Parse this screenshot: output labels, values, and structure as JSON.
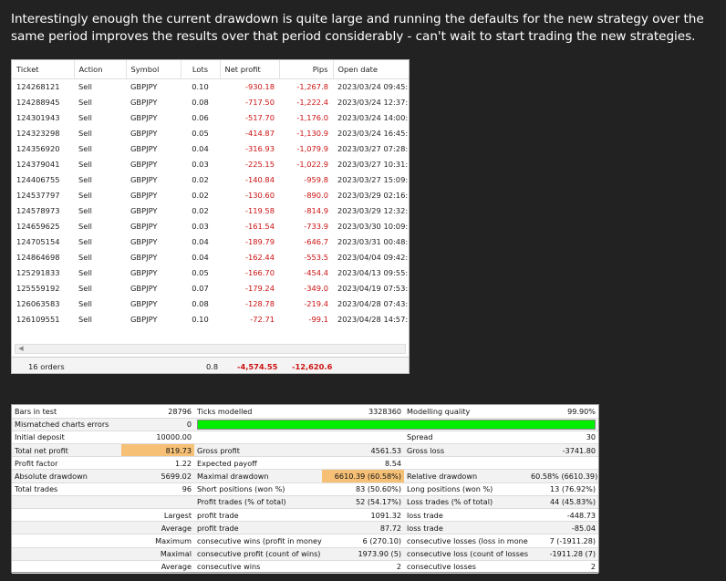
{
  "intro": "Interestingly enough the current drawdown is quite large and running the defaults for the new strategy over the same period improves the results over that period considerably - can't wait to start trading the new strategies.",
  "orders": {
    "columns": [
      "Ticket",
      "Action",
      "Symbol",
      "Lots",
      "Net profit",
      "Pips",
      "Open date"
    ],
    "rows": [
      [
        "124268121",
        "Sell",
        "GBPJPY",
        "0.10",
        "-930.18",
        "-1,267.8",
        "2023/03/24 09:45:..."
      ],
      [
        "124288945",
        "Sell",
        "GBPJPY",
        "0.08",
        "-717.50",
        "-1,222.4",
        "2023/03/24 12:37:..."
      ],
      [
        "124301943",
        "Sell",
        "GBPJPY",
        "0.06",
        "-517.70",
        "-1,176.0",
        "2023/03/24 14:00:..."
      ],
      [
        "124323298",
        "Sell",
        "GBPJPY",
        "0.05",
        "-414.87",
        "-1,130.9",
        "2023/03/24 16:45:..."
      ],
      [
        "124356920",
        "Sell",
        "GBPJPY",
        "0.04",
        "-316.93",
        "-1,079.9",
        "2023/03/27 07:28:..."
      ],
      [
        "124379041",
        "Sell",
        "GBPJPY",
        "0.03",
        "-225.15",
        "-1,022.9",
        "2023/03/27 10:31:..."
      ],
      [
        "124406755",
        "Sell",
        "GBPJPY",
        "0.02",
        "-140.84",
        "-959.8",
        "2023/03/27 15:09:..."
      ],
      [
        "124537797",
        "Sell",
        "GBPJPY",
        "0.02",
        "-130.60",
        "-890.0",
        "2023/03/29 02:16:..."
      ],
      [
        "124578973",
        "Sell",
        "GBPJPY",
        "0.02",
        "-119.58",
        "-814.9",
        "2023/03/29 12:32:..."
      ],
      [
        "124659625",
        "Sell",
        "GBPJPY",
        "0.03",
        "-161.54",
        "-733.9",
        "2023/03/30 10:09:..."
      ],
      [
        "124705154",
        "Sell",
        "GBPJPY",
        "0.04",
        "-189.79",
        "-646.7",
        "2023/03/31 00:48:..."
      ],
      [
        "124864698",
        "Sell",
        "GBPJPY",
        "0.04",
        "-162.44",
        "-553.5",
        "2023/04/04 09:42:..."
      ],
      [
        "125291833",
        "Sell",
        "GBPJPY",
        "0.05",
        "-166.70",
        "-454.4",
        "2023/04/13 09:55:..."
      ],
      [
        "125559192",
        "Sell",
        "GBPJPY",
        "0.07",
        "-179.24",
        "-349.0",
        "2023/04/19 07:53:..."
      ],
      [
        "126063583",
        "Sell",
        "GBPJPY",
        "0.08",
        "-128.78",
        "-219.4",
        "2023/04/28 07:43:..."
      ],
      [
        "126109551",
        "Sell",
        "GBPJPY",
        "0.10",
        "-72.71",
        "-99.1",
        "2023/04/28 14:57:..."
      ]
    ],
    "summary": {
      "count": "16 orders",
      "lots": "0.8",
      "net_profit": "-4,574.55",
      "pips": "-12,620.6"
    }
  },
  "report": {
    "rows": [
      [
        "Bars in test",
        "28796",
        "Ticks modelled",
        "3328360",
        "Modelling quality",
        "99.90%"
      ],
      [
        "Mismatched charts errors",
        "0",
        "__bar__",
        "",
        "",
        ""
      ],
      [
        "Initial deposit",
        "10000.00",
        "",
        "",
        "Spread",
        "30"
      ],
      [
        "Total net profit",
        "819.73",
        "Gross profit",
        "4561.53",
        "Gross loss",
        "-3741.80"
      ],
      [
        "Profit factor",
        "1.22",
        "Expected payoff",
        "8.54",
        "",
        ""
      ],
      [
        "Absolute drawdown",
        "5699.02",
        "Maximal drawdown",
        "6610.39 (60.58%)",
        "Relative drawdown",
        "60.58% (6610.39)"
      ],
      [
        "Total trades",
        "96",
        "Short positions (won %)",
        "83 (50.60%)",
        "Long positions (won %)",
        "13 (76.92%)"
      ],
      [
        "",
        "",
        "Profit trades (% of total)",
        "52 (54.17%)",
        "Loss trades (% of total)",
        "44 (45.83%)"
      ],
      [
        "",
        "Largest",
        "profit trade",
        "1091.32",
        "loss trade",
        "-448.73"
      ],
      [
        "",
        "Average",
        "profit trade",
        "87.72",
        "loss trade",
        "-85.04"
      ],
      [
        "",
        "Maximum",
        "consecutive wins (profit in money)",
        "6 (270.10)",
        "consecutive losses (loss in money)",
        "7 (-1911.28)"
      ],
      [
        "",
        "Maximal",
        "consecutive profit (count of wins)",
        "1973.90 (5)",
        "consecutive loss (count of losses)",
        "-1911.28 (7)"
      ],
      [
        "",
        "Average",
        "consecutive wins",
        "2",
        "consecutive losses",
        "2"
      ]
    ],
    "modelling_bar_fill": 1.0,
    "bar_color": "#00ee00",
    "highlight_color": "#f6c176"
  }
}
